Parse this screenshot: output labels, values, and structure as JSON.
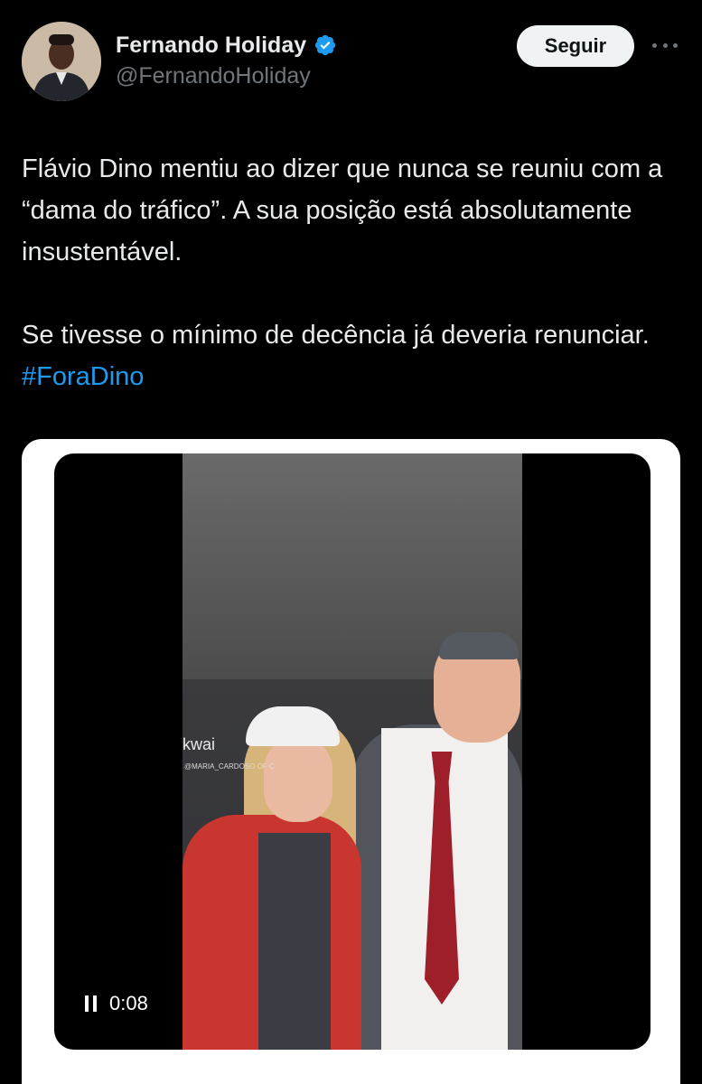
{
  "tweet": {
    "author": {
      "display_name": "Fernando Holiday",
      "handle": "@FernandoHoliday",
      "verified": true
    },
    "follow_label": "Seguir",
    "text_paragraph_1": "Flávio Dino mentiu ao dizer que nunca se reuniu com a “dama do tráfico”. A sua posição está absolutamente insustentável.",
    "text_paragraph_2_prefix": "Se tivesse o mínimo de decência já deveria renunciar. ",
    "hashtag": "#ForaDino"
  },
  "media": {
    "watermark": "kwai",
    "watermark_sub": "@MARIA_CARDOSO OF C",
    "time": "0:08",
    "state": "playing"
  },
  "colors": {
    "background": "#000000",
    "text": "#e7e9ea",
    "secondary_text": "#71767b",
    "link": "#1d9bf0",
    "verified": "#1d9bf0",
    "follow_bg": "#eff3f4"
  }
}
